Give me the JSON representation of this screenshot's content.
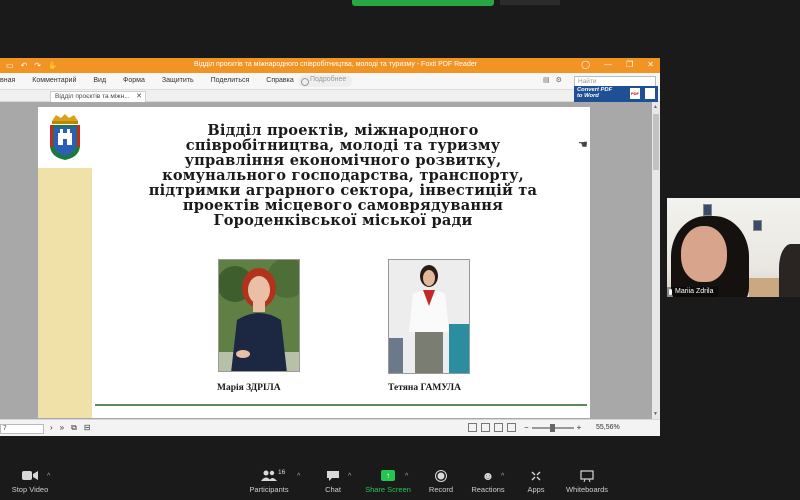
{
  "reader": {
    "window_title": "Відділ проєктів та міжнародного співробітництва, молоді та туризму - Foxit PDF Reader",
    "menu": [
      "вная",
      "Комментарий",
      "Вид",
      "Форма",
      "Защитить",
      "Поделиться",
      "Справка"
    ],
    "hint": "Подробнее",
    "search_placeholder": "Найти",
    "tab_label": "Відділ проєктів та міжн...",
    "ad_text": "Convert PDF to Word",
    "page_number": "7",
    "zoom_level": "55,56%"
  },
  "slide": {
    "headline": [
      "Відділ проектів, міжнародного",
      "співробітництва, молоді та туризму",
      "управління економічного розвитку,",
      "комунального господарства, транспорту,",
      "підтримки аграрного сектора, інвестицій та",
      "проектів місцевого самоврядування",
      "Городенківської міської ради"
    ],
    "person1": "Марія ЗДРІЛА",
    "person2": "Тетяна ГАМУЛА"
  },
  "video": {
    "participant_name": "Mariia Zdrila"
  },
  "toolbar": {
    "stop_video": "Stop Video",
    "participants": "Participants",
    "participants_count": "16",
    "chat": "Chat",
    "share_screen": "Share Screen",
    "record": "Record",
    "reactions": "Reactions",
    "apps": "Apps",
    "whiteboards": "Whiteboards"
  },
  "colors": {
    "titlebar": "#f29423",
    "share_green": "#23c552",
    "slide_stripe": "#efe1a7"
  }
}
